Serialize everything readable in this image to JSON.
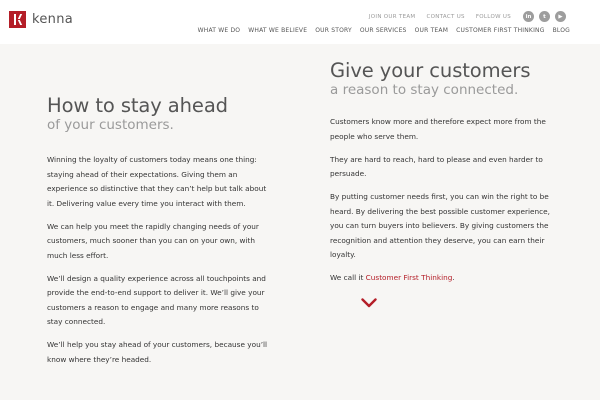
{
  "brand": {
    "name": "kenna",
    "accent_color": "#b41e28",
    "logo_icon": "kenna-logo-mark"
  },
  "utility_nav": {
    "join_our_team": "JOIN OUR TEAM",
    "contact_us": "CONTACT US",
    "follow_us": "FOLLOW US",
    "social": [
      {
        "icon": "linkedin-icon",
        "glyph": "in"
      },
      {
        "icon": "twitter-icon",
        "glyph": "t"
      },
      {
        "icon": "youtube-icon",
        "glyph": "▶"
      }
    ]
  },
  "main_nav": [
    "WHAT WE DO",
    "WHAT WE BELIEVE",
    "OUR STORY",
    "OUR SERVICES",
    "OUR TEAM",
    "CUSTOMER FIRST THINKING",
    "BLOG"
  ],
  "left": {
    "title": "How to stay ahead",
    "subtitle": "of your customers.",
    "paragraphs": [
      "Winning the loyalty of customers today means one thing: staying ahead of their expectations. Giving them an experience so distinctive that they can’t help but talk about it. Delivering value every time you interact with them.",
      "We can help you meet the rapidly changing needs of your customers, much sooner than you can on your own, with much less effort.",
      "We’ll design a quality experience across all touchpoints and provide the end-to-end support to deliver it. We’ll give your customers a reason to engage and many more reasons to stay connected.",
      "We’ll help you stay ahead of your customers, because you’ll know where they’re headed."
    ]
  },
  "right": {
    "title": "Give your customers",
    "subtitle": "a reason to stay connected.",
    "paragraphs": [
      "Customers know more and therefore expect more from the people who serve them.",
      "They are hard to reach, hard to please and even harder to persuade.",
      "By putting customer needs first, you can win the right to be heard. By delivering the best possible customer experience, you can turn buyers into believers. By giving customers the recognition and attention they deserve, you can earn their loyalty."
    ],
    "cta_prefix": "We call it ",
    "cta_link": "Customer First Thinking",
    "cta_suffix": ".",
    "scroll_icon": "chevron-down-icon"
  }
}
